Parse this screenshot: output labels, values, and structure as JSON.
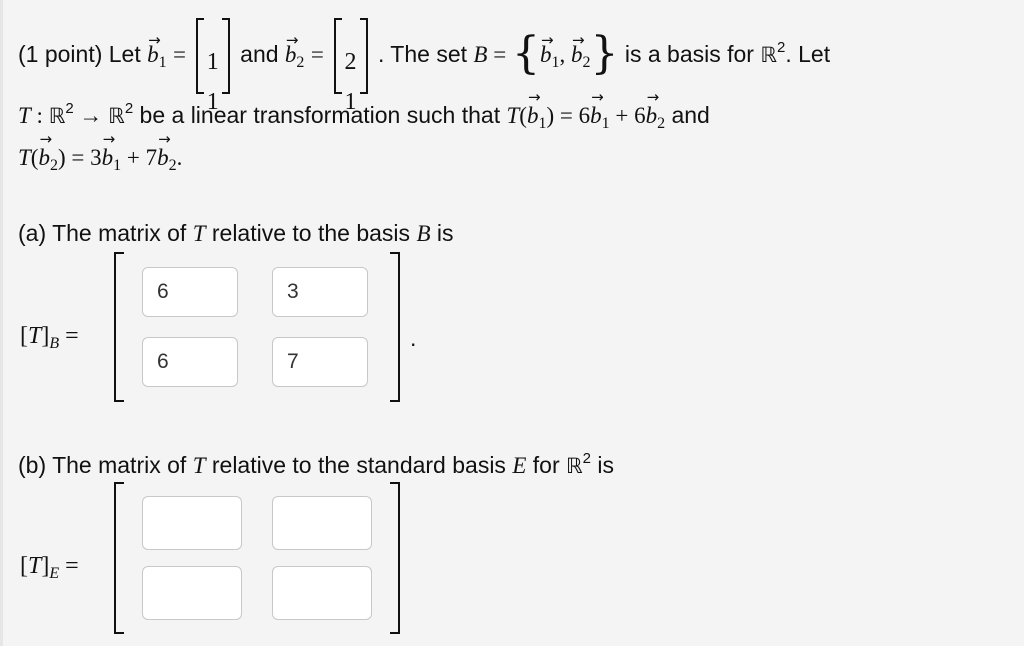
{
  "problem": {
    "points_label": "(1 point) Let",
    "and_word": "and",
    "the_set_text": ". The set",
    "basis_text": "is a basis for",
    "let_text": ". Let",
    "b1_vector": [
      "1",
      "1"
    ],
    "b2_vector": [
      "2",
      "1"
    ],
    "transform_intro": "be a linear transformation such that",
    "and_word2": "and",
    "T_b1_coeffs": [
      "6",
      "6"
    ],
    "T_b2_coeffs": [
      "3",
      "7"
    ]
  },
  "part_a": {
    "prompt_prefix": "(a) The matrix of",
    "prompt_middle": "relative to the basis",
    "prompt_suffix": "is",
    "lhs_subscript": "B",
    "cells": [
      "6",
      "3",
      "6",
      "7"
    ],
    "trailing": "."
  },
  "part_b": {
    "prompt_prefix": "(b) The matrix of",
    "prompt_middle": "relative to the standard basis",
    "prompt_for": "for",
    "prompt_suffix": "is",
    "lhs_subscript": "E",
    "cells": [
      "",
      "",
      "",
      ""
    ]
  }
}
